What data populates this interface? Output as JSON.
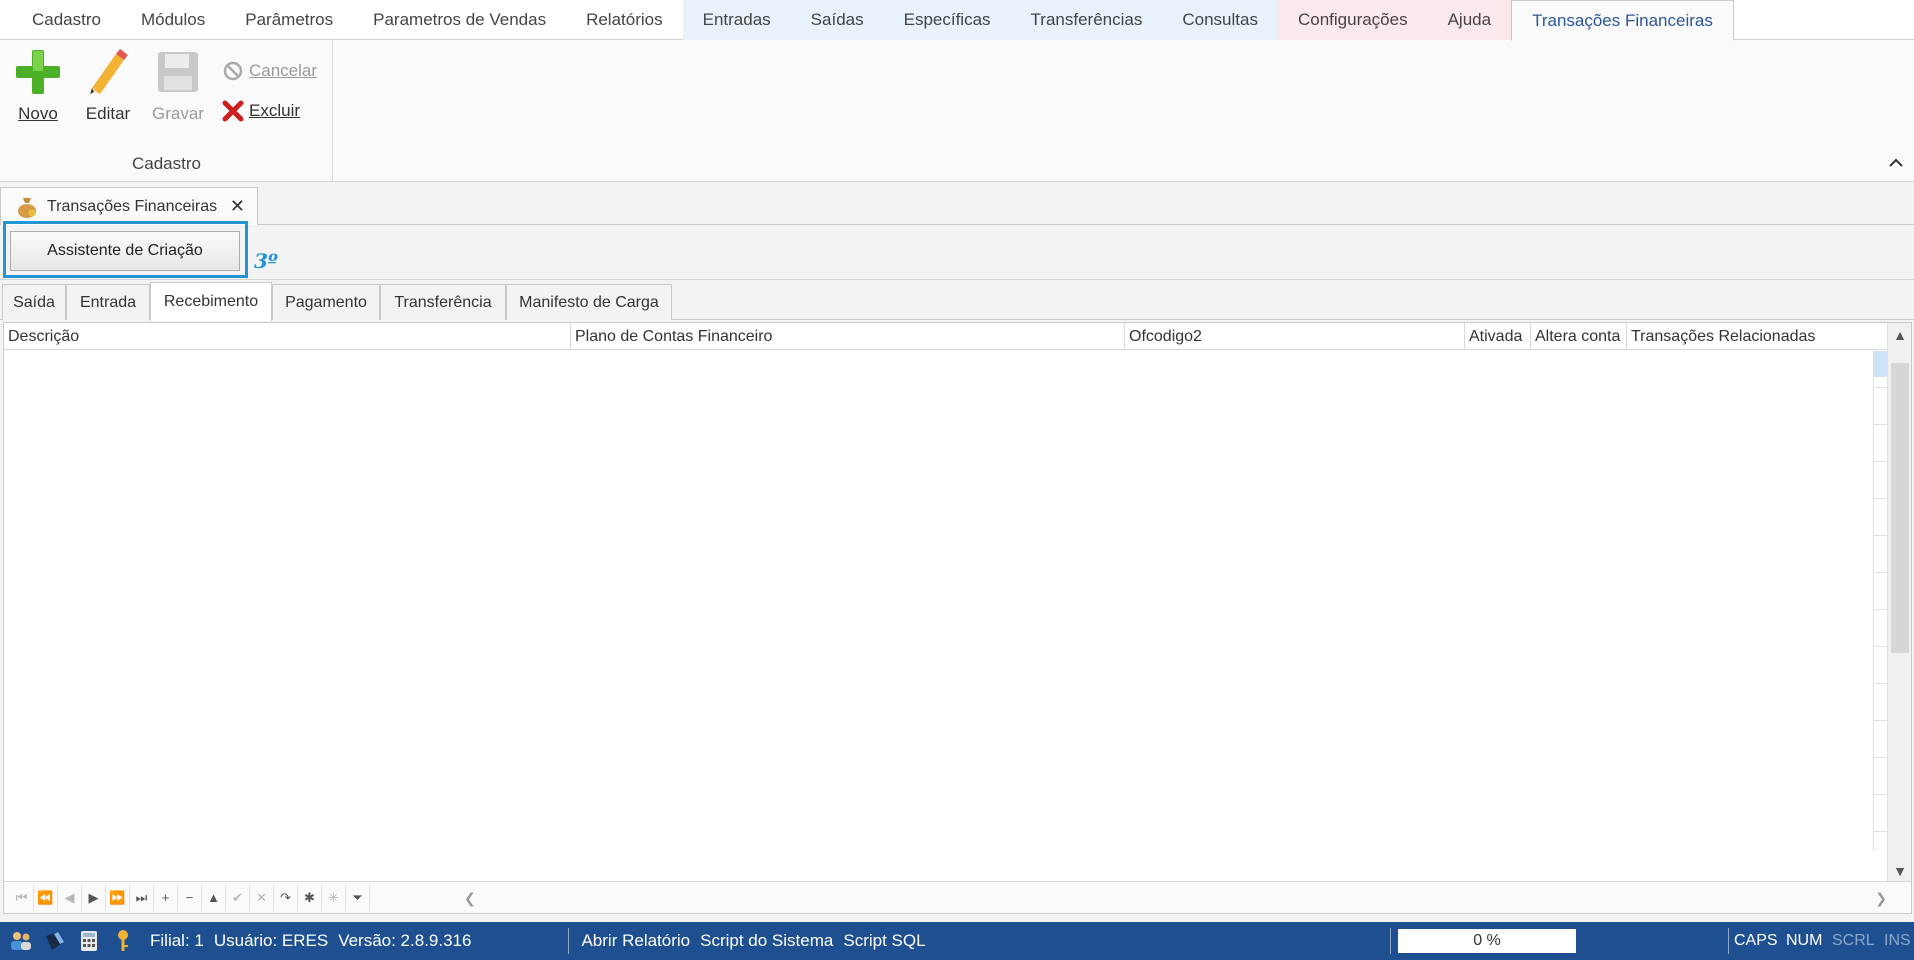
{
  "menu": {
    "tabs": [
      {
        "label": "Cadastro",
        "tone": "plain"
      },
      {
        "label": "Módulos",
        "tone": "plain"
      },
      {
        "label": "Parâmetros",
        "tone": "plain"
      },
      {
        "label": "Parametros de Vendas",
        "tone": "plain"
      },
      {
        "label": "Relatórios",
        "tone": "plain"
      },
      {
        "label": "Entradas",
        "tone": "blue"
      },
      {
        "label": "Saídas",
        "tone": "blue"
      },
      {
        "label": "Específicas",
        "tone": "blue"
      },
      {
        "label": "Transferências",
        "tone": "blue"
      },
      {
        "label": "Consultas",
        "tone": "blue"
      },
      {
        "label": "Configurações",
        "tone": "pink"
      },
      {
        "label": "Ajuda",
        "tone": "pink"
      },
      {
        "label": "Transações Financeiras",
        "tone": "active"
      }
    ]
  },
  "ribbon": {
    "novo": "Novo",
    "editar": "Editar",
    "gravar": "Gravar",
    "cancelar": "Cancelar",
    "excluir": "Excluir",
    "group_label": "Cadastro",
    "collapse_glyph": "^"
  },
  "doc_tab": {
    "title": "Transações Financeiras",
    "close": "✕"
  },
  "assistant": {
    "button": "Assistente de Criação",
    "annotation": "3º"
  },
  "sub_tabs": [
    {
      "label": "Saída",
      "active": false
    },
    {
      "label": "Entrada",
      "active": false
    },
    {
      "label": "Recebimento",
      "active": true
    },
    {
      "label": "Pagamento",
      "active": false
    },
    {
      "label": "Transferência",
      "active": false
    },
    {
      "label": "Manifesto de Carga",
      "active": false
    }
  ],
  "grid": {
    "columns": [
      "Descrição",
      "Plano de Contas Financeiro",
      "Ofcodigo2",
      "Ativada",
      "Altera conta",
      "Transações Relacionadas"
    ],
    "rows": []
  },
  "status": {
    "filial": "Filial: 1",
    "usuario": "Usuário: ERES",
    "versao": "Versão: 2.8.9.316",
    "abrir_relatorio": "Abrir Relatório",
    "script_sistema": "Script do Sistema",
    "script_sql": "Script SQL",
    "progress": "0 %",
    "caps": "CAPS",
    "num": "NUM",
    "scrl": "SCRL",
    "ins": "INS"
  },
  "colors": {
    "accent": "#2b579a",
    "highlight": "#2196d3",
    "statusbar": "#1d4f91"
  }
}
